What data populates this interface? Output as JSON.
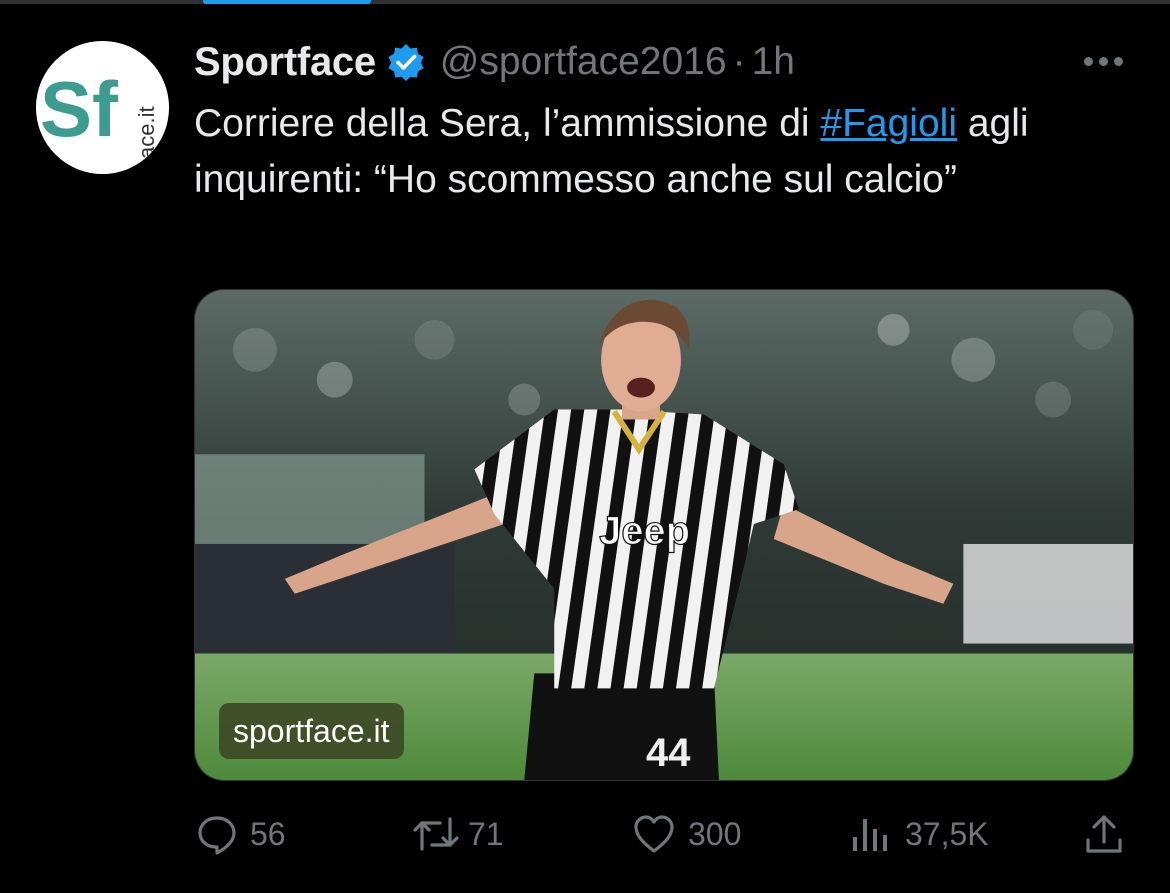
{
  "tweet": {
    "author_name": "Sportface",
    "handle": "@sportface2016",
    "separator": "·",
    "time": "1h",
    "text_before": "Corriere della Sera, l’ammissione di ",
    "hashtag": "#Fagioli",
    "text_after": " agli inquirenti: “Ho scommesso anche sul calcio”",
    "media_watermark": "sportface.it",
    "avatar_letters": "Sf",
    "avatar_small": "ace.it",
    "jersey_brand": "Jeep",
    "jersey_number": "44"
  },
  "actions": {
    "reply_count": "56",
    "retweet_count": "71",
    "like_count": "300",
    "views_count": "37,5K"
  },
  "icons": {
    "reply": "speech-bubble-icon",
    "retweet": "retweet-arrows-icon",
    "like": "heart-icon",
    "views": "bar-chart-icon",
    "share": "share-upload-icon",
    "verified": "verified-badge-icon",
    "more": "more-dots-icon"
  },
  "colors": {
    "background": "#000000",
    "text": "#e7e9ea",
    "secondary": "#71767b",
    "accent": "#1d9bf0",
    "brand_green": "#3b9c8f"
  }
}
